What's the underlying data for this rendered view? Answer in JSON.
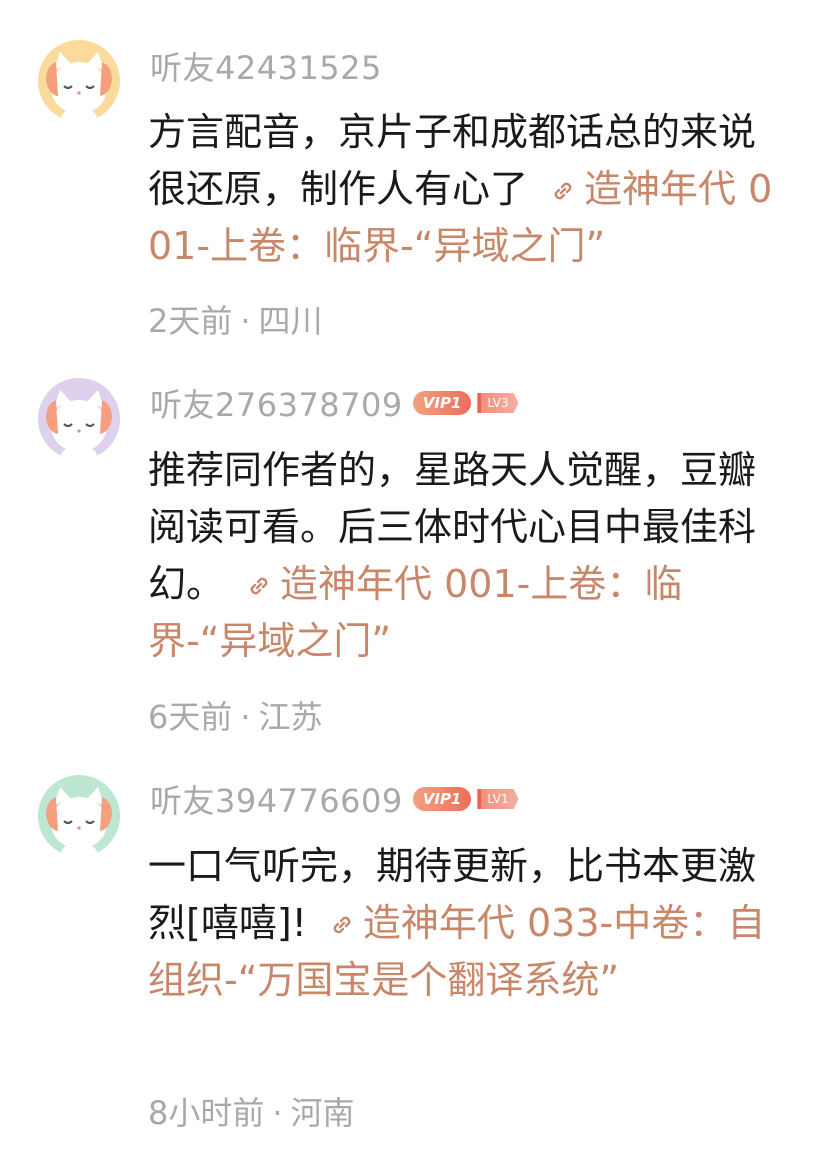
{
  "colors": {
    "username_gray": "#a9a9a9",
    "link_accent": "#c9876a",
    "vip_badge": "#ec6e58",
    "avatar_bg": [
      "#fbdb9c",
      "#ddd1ee",
      "#bde6d3"
    ]
  },
  "comments": [
    {
      "username": "听友42431525",
      "text": "方言配音，京片子和成都话总的来说很还原，制作人有心了",
      "link": "造神年代 001-上卷：临界-“异域之门”",
      "time": "2天前",
      "separator": "·",
      "location": "四川"
    },
    {
      "username": "听友276378709",
      "vip": "VIP1",
      "level": "LV3",
      "text": "推荐同作者的，星路天人觉醒，豆瓣阅读可看。后三体时代心目中最佳科幻。",
      "link": "造神年代 001-上卷：临界-“异域之门”",
      "time": "6天前",
      "separator": "·",
      "location": "江苏"
    },
    {
      "username": "听友394776609",
      "vip": "VIP1",
      "level": "LV1",
      "text": "一口气听完，期待更新，比书本更激烈[嘻嘻]!",
      "link": "造神年代 033-中卷：自组织-“万国宝是个翻译系统”",
      "time": "8小时前",
      "separator": "·",
      "location": "河南"
    }
  ]
}
